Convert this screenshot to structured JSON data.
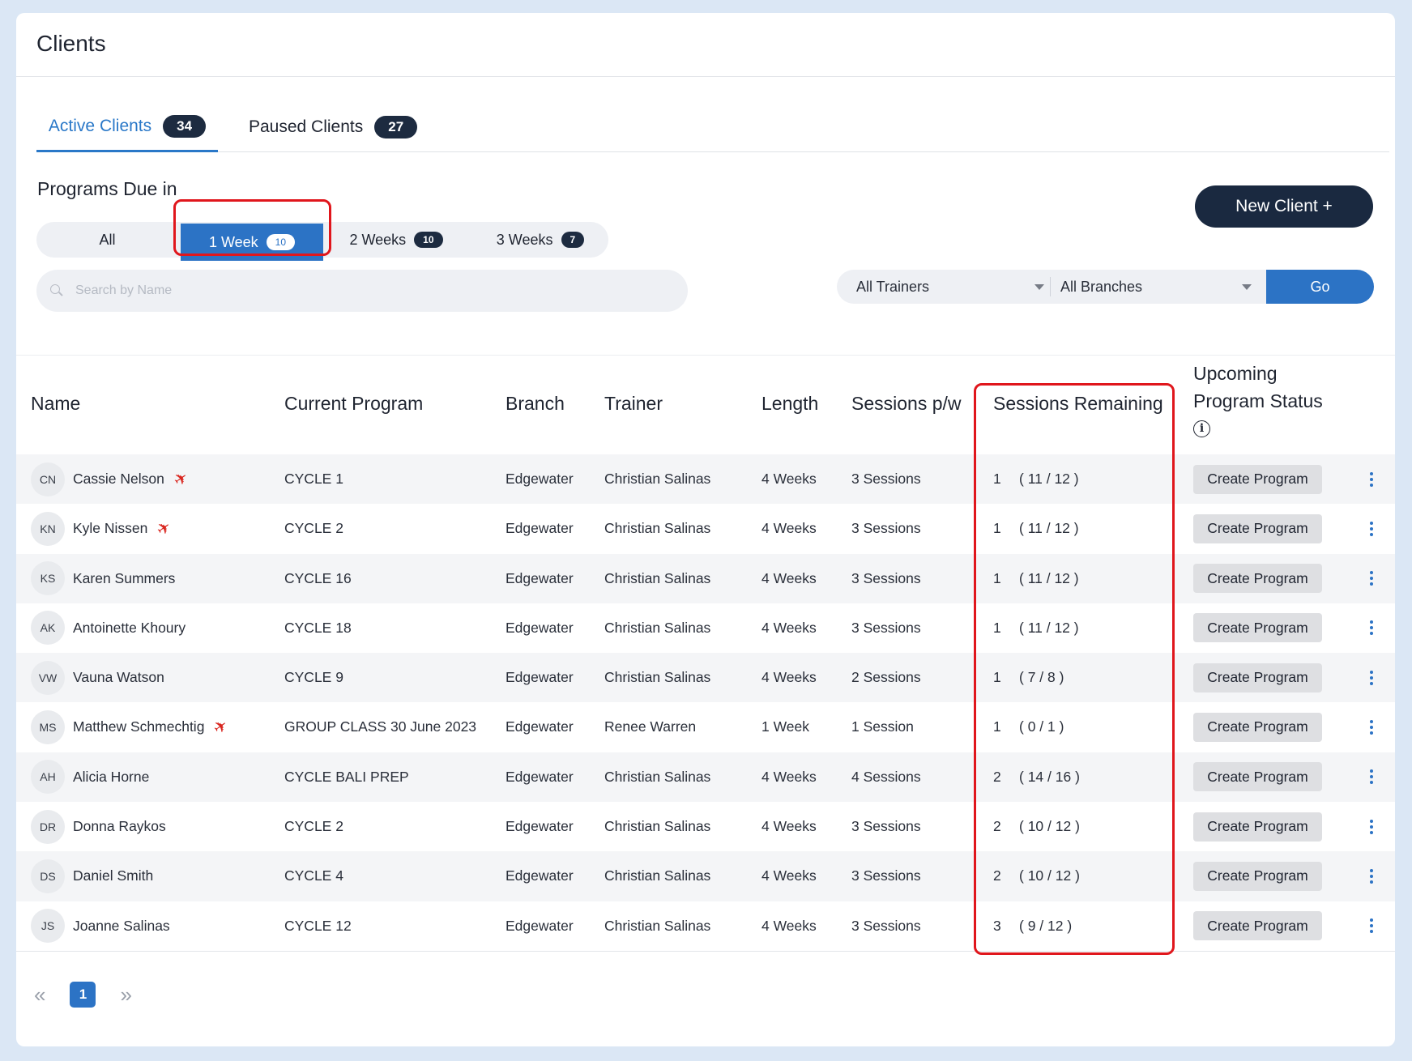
{
  "page": {
    "title": "Clients"
  },
  "tabs": [
    {
      "label": "Active Clients",
      "count": "34"
    },
    {
      "label": "Paused Clients",
      "count": "27"
    }
  ],
  "programs_due": {
    "label": "Programs Due in",
    "options": [
      {
        "label": "All",
        "count": ""
      },
      {
        "label": "1 Week",
        "count": "10"
      },
      {
        "label": "2 Weeks",
        "count": "10"
      },
      {
        "label": "3 Weeks",
        "count": "7"
      }
    ],
    "selected": "1 Week"
  },
  "new_client_label": "New Client +",
  "search": {
    "placeholder": "Search by Name",
    "value": ""
  },
  "filters": {
    "trainers": "All Trainers",
    "branches": "All Branches",
    "go_label": "Go"
  },
  "table": {
    "headers": {
      "name": "Name",
      "program": "Current Program",
      "branch": "Branch",
      "trainer": "Trainer",
      "length": "Length",
      "sessions_pw": "Sessions p/w",
      "remaining": "Sessions Remaining",
      "status_line1": "Upcoming",
      "status_line2": "Program Status"
    },
    "action_label": "Create Program",
    "rows": [
      {
        "initials": "CN",
        "name": "Cassie Nelson",
        "travel": true,
        "program": "CYCLE 1",
        "branch": "Edgewater",
        "trainer": "Christian Salinas",
        "length": "4 Weeks",
        "sessions": "3 Sessions",
        "remaining": "1",
        "ratio": "( 11 / 12 )"
      },
      {
        "initials": "KN",
        "name": "Kyle Nissen",
        "travel": true,
        "program": "CYCLE 2",
        "branch": "Edgewater",
        "trainer": "Christian Salinas",
        "length": "4 Weeks",
        "sessions": "3 Sessions",
        "remaining": "1",
        "ratio": "( 11 / 12 )"
      },
      {
        "initials": "KS",
        "name": "Karen Summers",
        "travel": false,
        "program": "CYCLE 16",
        "branch": "Edgewater",
        "trainer": "Christian Salinas",
        "length": "4 Weeks",
        "sessions": "3 Sessions",
        "remaining": "1",
        "ratio": "( 11 / 12 )"
      },
      {
        "initials": "AK",
        "name": "Antoinette Khoury",
        "travel": false,
        "program": "CYCLE 18",
        "branch": "Edgewater",
        "trainer": "Christian Salinas",
        "length": "4 Weeks",
        "sessions": "3 Sessions",
        "remaining": "1",
        "ratio": "( 11 / 12 )"
      },
      {
        "initials": "VW",
        "name": "Vauna Watson",
        "travel": false,
        "program": "CYCLE 9",
        "branch": "Edgewater",
        "trainer": "Christian Salinas",
        "length": "4 Weeks",
        "sessions": "2 Sessions",
        "remaining": "1",
        "ratio": "( 7 / 8 )"
      },
      {
        "initials": "MS",
        "name": "Matthew Schmechtig",
        "travel": true,
        "program": "GROUP CLASS 30 June 2023",
        "branch": "Edgewater",
        "trainer": "Renee Warren",
        "length": "1 Week",
        "sessions": "1 Session",
        "remaining": "1",
        "ratio": "( 0 / 1 )"
      },
      {
        "initials": "AH",
        "name": "Alicia Horne",
        "travel": false,
        "program": "CYCLE BALI PREP",
        "branch": "Edgewater",
        "trainer": "Christian Salinas",
        "length": "4 Weeks",
        "sessions": "4 Sessions",
        "remaining": "2",
        "ratio": "( 14 / 16 )"
      },
      {
        "initials": "DR",
        "name": "Donna Raykos",
        "travel": false,
        "program": "CYCLE 2",
        "branch": "Edgewater",
        "trainer": "Christian Salinas",
        "length": "4 Weeks",
        "sessions": "3 Sessions",
        "remaining": "2",
        "ratio": "( 10 / 12 )"
      },
      {
        "initials": "DS",
        "name": "Daniel Smith",
        "travel": false,
        "program": "CYCLE 4",
        "branch": "Edgewater",
        "trainer": "Christian Salinas",
        "length": "4 Weeks",
        "sessions": "3 Sessions",
        "remaining": "2",
        "ratio": "( 10 / 12 )"
      },
      {
        "initials": "JS",
        "name": "Joanne Salinas",
        "travel": false,
        "program": "CYCLE 12",
        "branch": "Edgewater",
        "trainer": "Christian Salinas",
        "length": "4 Weeks",
        "sessions": "3 Sessions",
        "remaining": "3",
        "ratio": "( 9 / 12 )"
      }
    ]
  },
  "pagination": {
    "current_page": "1"
  },
  "colors": {
    "accent": "#2c73c5",
    "dark": "#1a2940",
    "highlight": "#e0161c",
    "travel_icon": "#d9261f"
  },
  "icons": [
    "search-icon",
    "caret-down-icon",
    "info-icon",
    "airplane-icon",
    "kebab-menu-icon",
    "chevron-double-left-icon",
    "chevron-double-right-icon"
  ]
}
